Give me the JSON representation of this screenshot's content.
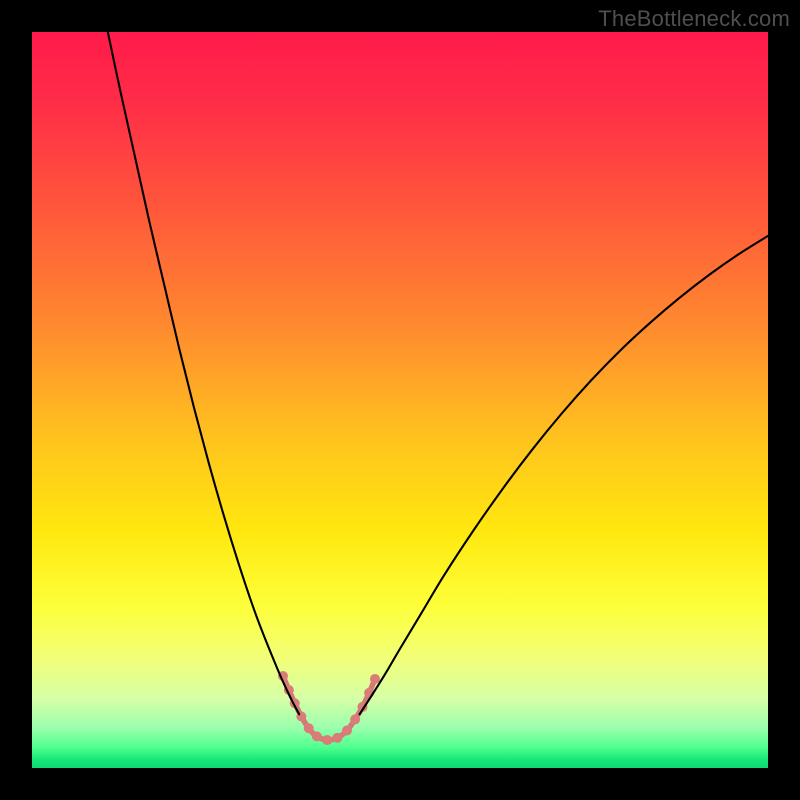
{
  "watermark": "TheBottleneck.com",
  "chart_data": {
    "type": "line",
    "title": "",
    "xlabel": "",
    "ylabel": "",
    "xlim": [
      0,
      100
    ],
    "ylim": [
      0,
      100
    ],
    "grid": false,
    "legend": false,
    "background_gradient_stops": [
      {
        "offset": 0.0,
        "color": "#ff1a4b"
      },
      {
        "offset": 0.1,
        "color": "#ff2e47"
      },
      {
        "offset": 0.25,
        "color": "#ff5a3a"
      },
      {
        "offset": 0.4,
        "color": "#ff8a2f"
      },
      {
        "offset": 0.55,
        "color": "#ffc21e"
      },
      {
        "offset": 0.68,
        "color": "#ffe80f"
      },
      {
        "offset": 0.78,
        "color": "#fdff3a"
      },
      {
        "offset": 0.85,
        "color": "#f2ff77"
      },
      {
        "offset": 0.905,
        "color": "#d7ffa6"
      },
      {
        "offset": 0.945,
        "color": "#9cffae"
      },
      {
        "offset": 0.972,
        "color": "#4fff8f"
      },
      {
        "offset": 0.988,
        "color": "#17e87a"
      },
      {
        "offset": 1.0,
        "color": "#0fd873"
      }
    ],
    "series": [
      {
        "name": "left-curve",
        "stroke": "#000000",
        "stroke_width": 2.1,
        "points": [
          {
            "x": 10.3,
            "y": 100.0
          },
          {
            "x": 12.0,
            "y": 92.0
          },
          {
            "x": 14.0,
            "y": 83.0
          },
          {
            "x": 16.0,
            "y": 74.0
          },
          {
            "x": 18.0,
            "y": 65.5
          },
          {
            "x": 20.0,
            "y": 57.0
          },
          {
            "x": 22.0,
            "y": 49.0
          },
          {
            "x": 24.0,
            "y": 41.5
          },
          {
            "x": 26.0,
            "y": 34.5
          },
          {
            "x": 28.0,
            "y": 28.0
          },
          {
            "x": 30.0,
            "y": 22.0
          },
          {
            "x": 31.5,
            "y": 18.0
          },
          {
            "x": 33.0,
            "y": 14.3
          },
          {
            "x": 34.2,
            "y": 11.5
          },
          {
            "x": 35.3,
            "y": 9.2
          },
          {
            "x": 36.3,
            "y": 7.3
          }
        ]
      },
      {
        "name": "right-curve",
        "stroke": "#000000",
        "stroke_width": 2.1,
        "points": [
          {
            "x": 44.5,
            "y": 7.3
          },
          {
            "x": 46.0,
            "y": 9.6
          },
          {
            "x": 48.0,
            "y": 12.8
          },
          {
            "x": 50.0,
            "y": 16.2
          },
          {
            "x": 53.0,
            "y": 21.2
          },
          {
            "x": 56.0,
            "y": 26.2
          },
          {
            "x": 60.0,
            "y": 32.3
          },
          {
            "x": 64.0,
            "y": 38.0
          },
          {
            "x": 68.0,
            "y": 43.3
          },
          {
            "x": 72.0,
            "y": 48.2
          },
          {
            "x": 76.0,
            "y": 52.7
          },
          {
            "x": 80.0,
            "y": 56.8
          },
          {
            "x": 84.0,
            "y": 60.5
          },
          {
            "x": 88.0,
            "y": 63.9
          },
          {
            "x": 92.0,
            "y": 67.0
          },
          {
            "x": 96.0,
            "y": 69.8
          },
          {
            "x": 100.0,
            "y": 72.3
          }
        ]
      }
    ],
    "valley_chain": {
      "stroke": "#d27a76",
      "stroke_width": 5.5,
      "bead_radius": 5.0,
      "bead_fill": "#da7d79",
      "points": [
        {
          "x": 34.1,
          "y": 12.5
        },
        {
          "x": 34.9,
          "y": 10.6
        },
        {
          "x": 35.7,
          "y": 8.8
        },
        {
          "x": 36.6,
          "y": 7.0
        },
        {
          "x": 37.6,
          "y": 5.4
        },
        {
          "x": 38.7,
          "y": 4.3
        },
        {
          "x": 40.1,
          "y": 3.8
        },
        {
          "x": 41.5,
          "y": 4.1
        },
        {
          "x": 42.8,
          "y": 5.1
        },
        {
          "x": 43.9,
          "y": 6.6
        },
        {
          "x": 44.9,
          "y": 8.3
        },
        {
          "x": 45.8,
          "y": 10.2
        },
        {
          "x": 46.6,
          "y": 12.1
        }
      ]
    }
  }
}
